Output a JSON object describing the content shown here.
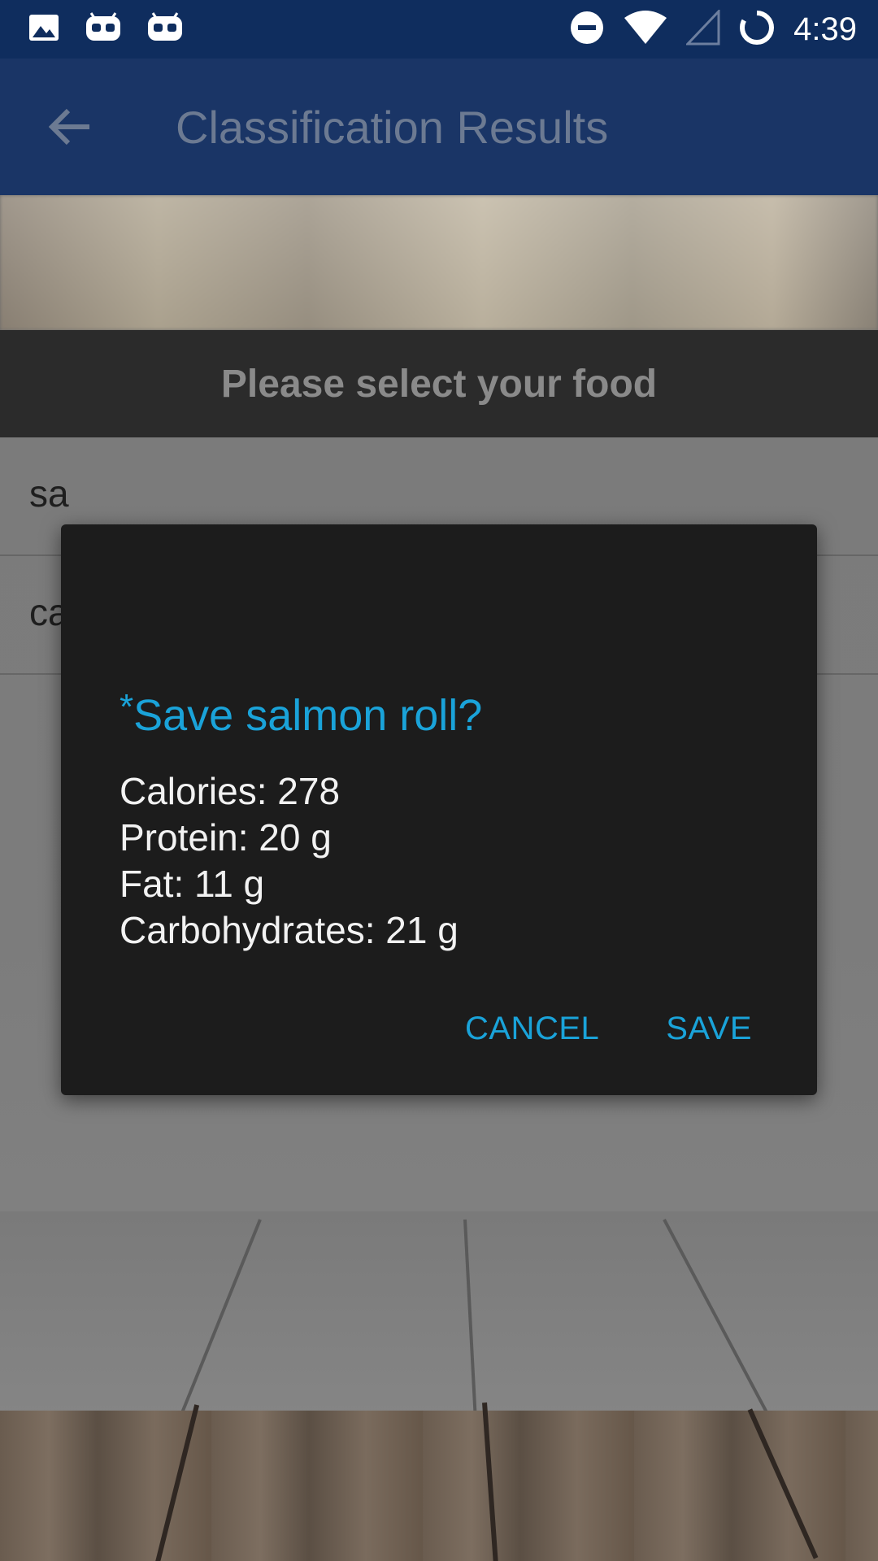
{
  "status_bar": {
    "time": "4:39",
    "icons": [
      "image-icon",
      "cyanogen-icon",
      "cyanogen-icon",
      "do-not-disturb-icon",
      "wifi-icon",
      "signal-icon",
      "sync-icon"
    ]
  },
  "app_bar": {
    "title": "Classification Results",
    "back_icon": "arrow-left-icon"
  },
  "background": {
    "select_prompt": "Please select your food",
    "list_items": [
      "sa",
      "ca"
    ]
  },
  "dialog": {
    "title_prefix": "*",
    "title": "Save salmon roll?",
    "nutrients": [
      "Calories: 278",
      "Protein: 20 g",
      "Fat: 11 g",
      "Carbohydrates: 21 g"
    ],
    "cancel_label": "CANCEL",
    "save_label": "SAVE"
  },
  "colors": {
    "status_bar": "#0f2d5e",
    "app_bar": "#1a3566",
    "dialog_bg": "#1c1c1c",
    "accent": "#1aa3d9"
  }
}
